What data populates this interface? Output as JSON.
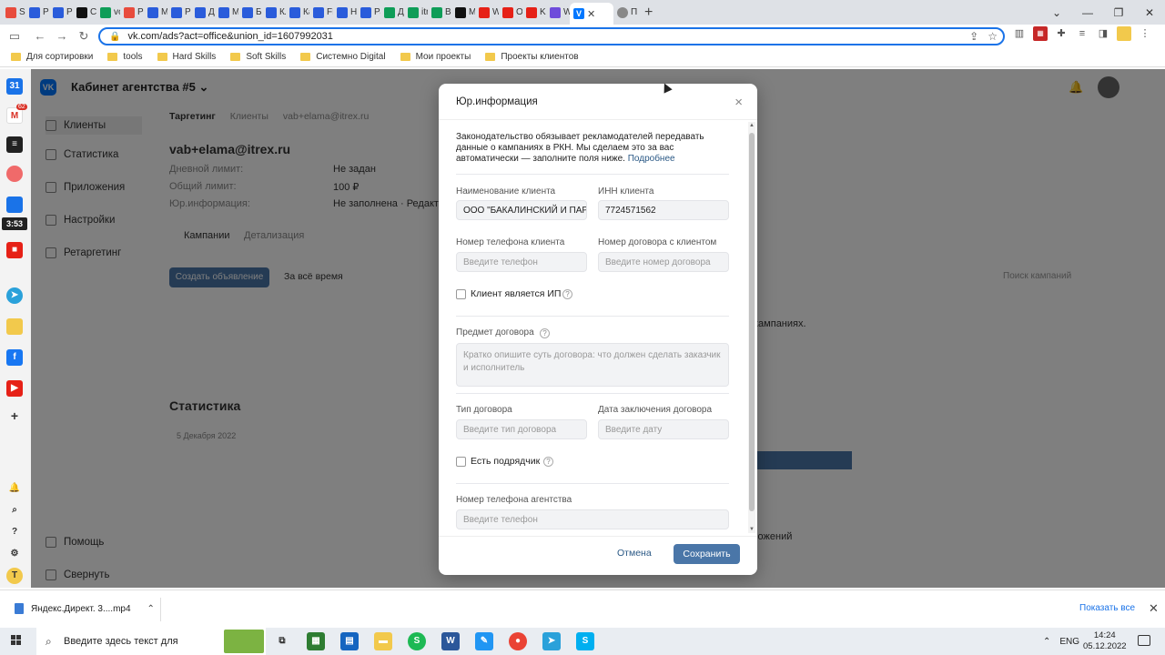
{
  "browser": {
    "tabs": [
      {
        "label": "Sis",
        "color": "#e84c3d"
      },
      {
        "label": "Pe",
        "color": "#2a5cdb"
      },
      {
        "label": "Pe",
        "color": "#2a5cdb"
      },
      {
        "label": "Co",
        "color": "#111111"
      },
      {
        "label": "voi",
        "color": "#0f9d58"
      },
      {
        "label": "Pia",
        "color": "#e84c3d"
      },
      {
        "label": "Me",
        "color": "#2a5cdb"
      },
      {
        "label": "Pe",
        "color": "#2a5cdb"
      },
      {
        "label": "До",
        "color": "#2a5cdb"
      },
      {
        "label": "Ме",
        "color": "#2a5cdb"
      },
      {
        "label": "Би",
        "color": "#2a5cdb"
      },
      {
        "label": "Кл",
        "color": "#2a5cdb"
      },
      {
        "label": "Ка",
        "color": "#2a5cdb"
      },
      {
        "label": "FB",
        "color": "#2a5cdb"
      },
      {
        "label": "На",
        "color": "#2a5cdb"
      },
      {
        "label": "Ра",
        "color": "#2a5cdb"
      },
      {
        "label": "Де",
        "color": "#0f9d58"
      },
      {
        "label": "itre",
        "color": "#0f9d58"
      },
      {
        "label": "Bri",
        "color": "#0f9d58"
      },
      {
        "label": "Mc",
        "color": "#111111"
      },
      {
        "label": "We",
        "color": "#e62117"
      },
      {
        "label": "Oc",
        "color": "#e62117"
      },
      {
        "label": "Ko",
        "color": "#e62117"
      },
      {
        "label": "W",
        "color": "#6f4cdb"
      }
    ],
    "active_tab": {
      "label": "",
      "close": "✕"
    },
    "after_tab": {
      "label": "Пр"
    },
    "new_tab": "+",
    "url": "vk.com/ads?act=office&union_id=1607992031",
    "bookmarks": [
      "Для сортировки",
      "tools",
      "Hard Skills",
      "Soft Skills",
      "Системно Digital",
      "Мои проекты",
      "Проекты клиентов"
    ]
  },
  "sidebar_apps": {
    "timer": "3:53",
    "badge_count": "62"
  },
  "vk": {
    "cabinet_title": "Кабинет агентства #5",
    "menu": [
      "Клиенты",
      "Статистика",
      "Приложения",
      "Настройки",
      "Ретаргетинг"
    ],
    "menu_bottom": [
      "Помощь",
      "Свернуть"
    ],
    "breadcrumbs": [
      "Таргетинг",
      "Клиенты",
      "vab+elama@itrex.ru"
    ],
    "client_email": "vab+elama@itrex.ru",
    "info_rows": [
      {
        "label": "Дневной лимит:",
        "value": "Не задан"
      },
      {
        "label": "Общий лимит:",
        "value": "100 ₽"
      },
      {
        "label": "Юр.информация:",
        "value": "Не заполнена · Редакти"
      }
    ],
    "tabs": [
      "Кампании",
      "Детализация"
    ],
    "create_ad": "Создать объявление",
    "period": "За всё время",
    "search_placeholder": "Поиск кампаний",
    "campaigns_text": "кампаниях.",
    "stats_title": "Статистика",
    "stats_date": "5 Декабря 2022",
    "apps_text": "ложений"
  },
  "modal": {
    "title": "Юр.информация",
    "close": "×",
    "notice": "Законодательство обязывает рекламодателей передавать данные о кампаниях в РКН. Мы сделаем это за вас автоматически — заполните поля ниже.",
    "notice_link": "Подробнее",
    "client_name_label": "Наименование клиента",
    "client_name_value": "ООО \"БАКАЛИНСКИЙ И ПАРТНЕРЫ\"",
    "inn_label": "ИНН клиента",
    "inn_value": "7724571562",
    "phone_label": "Номер телефона клиента",
    "phone_placeholder": "Введите телефон",
    "contract_no_label": "Номер договора с клиентом",
    "contract_no_placeholder": "Введите номер договора",
    "is_ip_label": "Клиент является ИП",
    "subject_label": "Предмет договора",
    "subject_placeholder": "Кратко опишите суть договора: что должен сделать заказчик и исполнитель",
    "contract_type_label": "Тип договора",
    "contract_type_placeholder": "Введите тип договора",
    "contract_date_label": "Дата заключения договора",
    "contract_date_placeholder": "Введите дату",
    "has_contractor_label": "Есть подрядчик",
    "agency_phone_label": "Номер телефона агентства",
    "agency_phone_placeholder": "Введите телефон",
    "cancel": "Отмена",
    "save": "Сохранить",
    "qmark": "?"
  },
  "downloads": {
    "file": "Яндекс.Директ. 3....mp4",
    "show_all": "Показать все",
    "close": "✕"
  },
  "taskbar": {
    "search_placeholder": "Введите здесь текст для",
    "lang": "ENG",
    "time": "14:24",
    "date": "05.12.2022"
  }
}
